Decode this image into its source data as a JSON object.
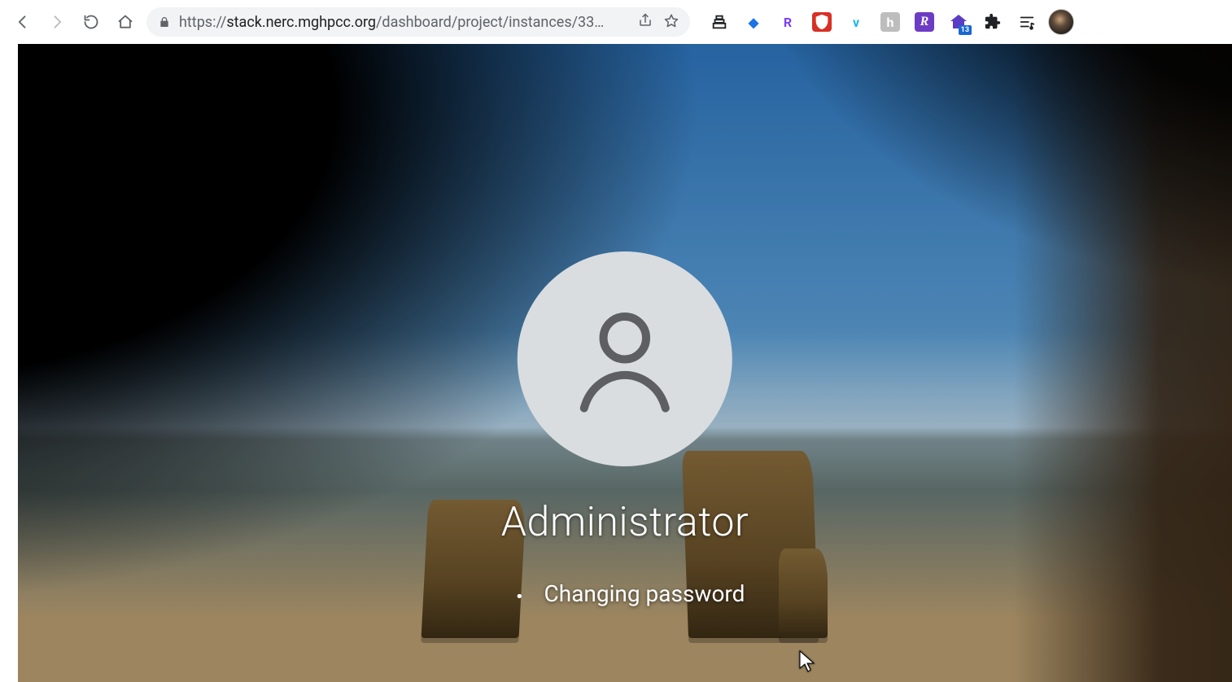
{
  "browser": {
    "url_protocol": "https://",
    "url_host": "stack.nerc.mghpcc.org",
    "url_path": "/dashboard/project/instances/33",
    "url_ellipsis": "…",
    "extensions": [
      {
        "id": "reading-list",
        "glyph": "",
        "style": "svg-stack",
        "color": "#202124",
        "bg": ""
      },
      {
        "id": "blue-diamond",
        "glyph": "◆",
        "style": "text",
        "color": "#1a73e8",
        "bg": ""
      },
      {
        "id": "rakuten",
        "glyph": "R",
        "style": "text",
        "color": "#7b3ff2",
        "bg": ""
      },
      {
        "id": "ublock",
        "glyph": "",
        "style": "svg-shield",
        "color": "#ffffff",
        "bg": "#d93025"
      },
      {
        "id": "vimeo",
        "glyph": "v",
        "style": "text",
        "color": "#1ab7ea",
        "bg": ""
      },
      {
        "id": "honey",
        "glyph": "h",
        "style": "text",
        "color": "#ffffff",
        "bg": "#bdbdbd"
      },
      {
        "id": "purple-r",
        "glyph": "R",
        "style": "text-italic",
        "color": "#ffffff",
        "bg": "#6c3cc4"
      },
      {
        "id": "purple-house",
        "glyph": "",
        "style": "svg-house",
        "color": "#5b3cc4",
        "bg": "",
        "badge": "13"
      },
      {
        "id": "extensions",
        "glyph": "",
        "style": "svg-puzzle",
        "color": "#202124",
        "bg": ""
      },
      {
        "id": "media-queue",
        "glyph": "",
        "style": "svg-queue",
        "color": "#202124",
        "bg": ""
      }
    ]
  },
  "login": {
    "username": "Administrator",
    "status": "Changing password"
  }
}
